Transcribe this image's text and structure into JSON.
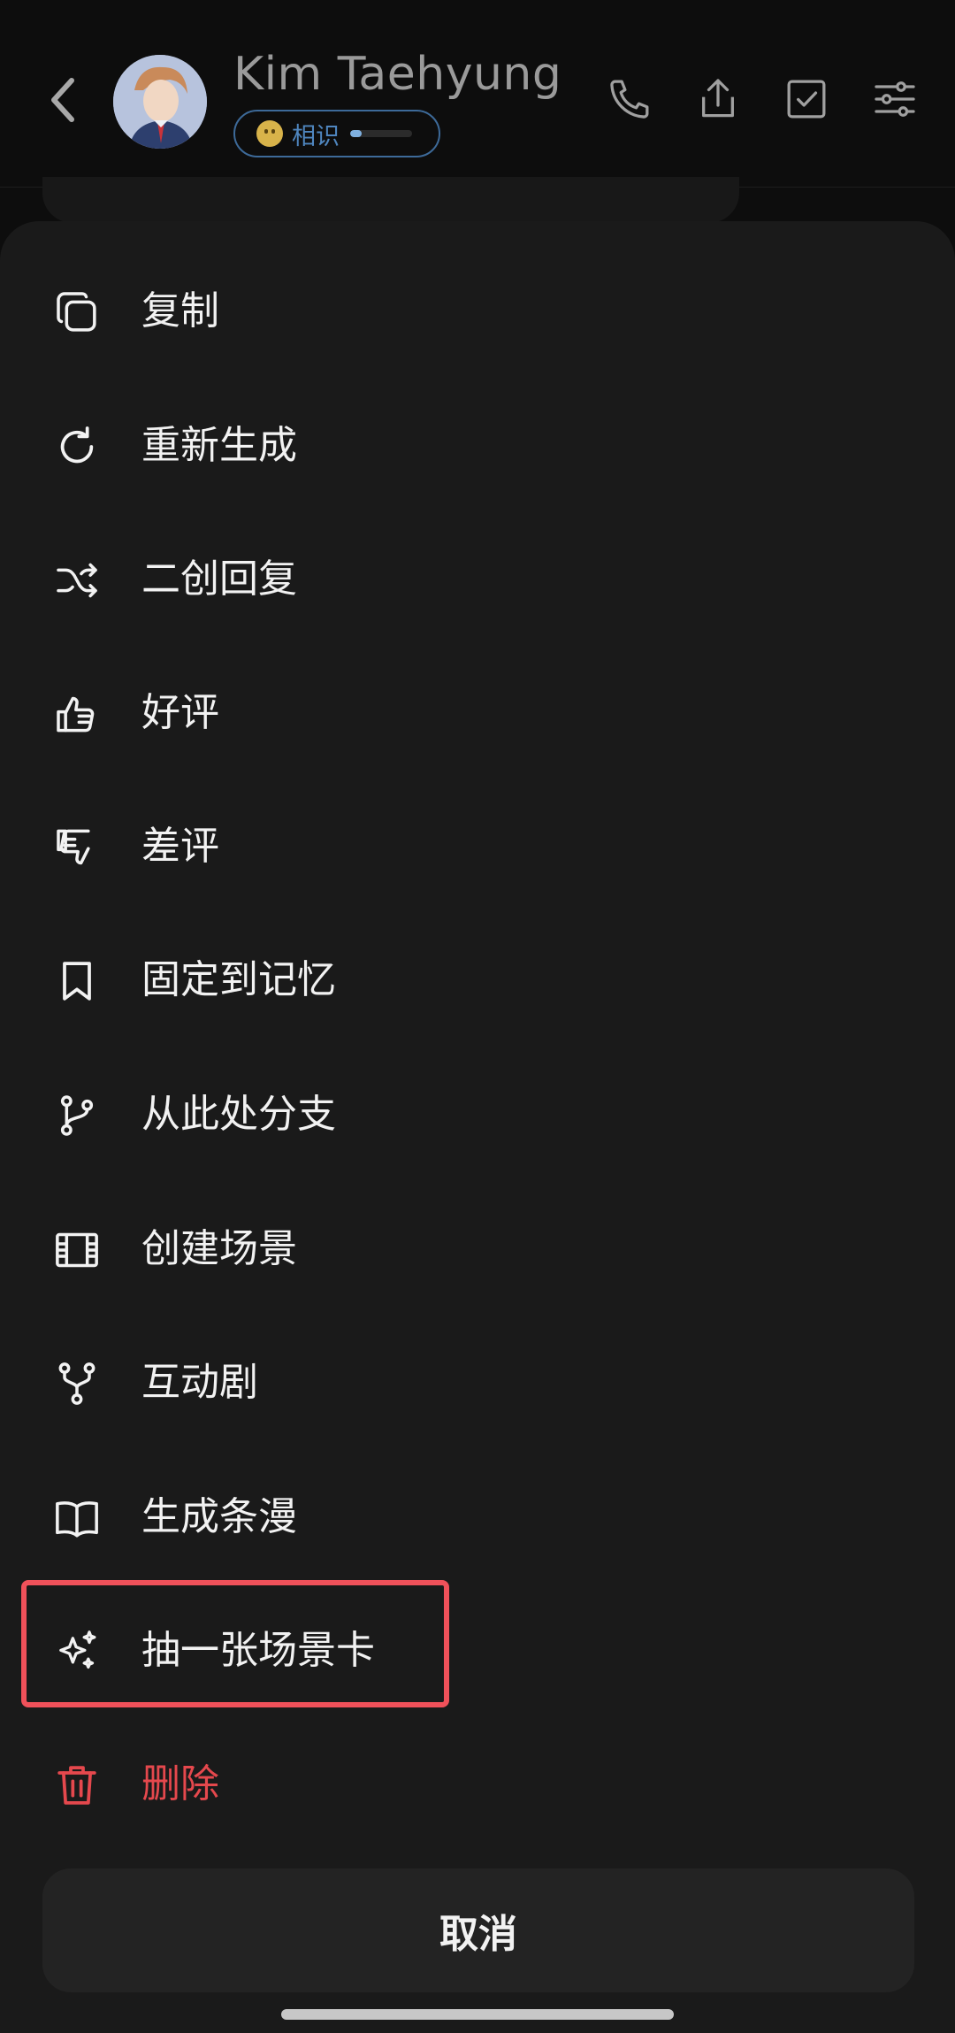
{
  "header": {
    "back_icon": "chevron-left-icon",
    "contact_name": "Kim Taehyung",
    "relation": {
      "emoji_icon": "smile-face-icon",
      "label": "相识",
      "progress": 0.18,
      "color": "#4f86bf"
    },
    "actions": [
      {
        "icon": "phone-icon"
      },
      {
        "icon": "share-icon"
      },
      {
        "icon": "checkbox-icon"
      },
      {
        "icon": "sliders-icon"
      }
    ]
  },
  "menu": {
    "items": [
      {
        "label": "复制",
        "icon": "copy-icon"
      },
      {
        "label": "重新生成",
        "icon": "regenerate-icon"
      },
      {
        "label": "二创回复",
        "icon": "shuffle-icon"
      },
      {
        "label": "好评",
        "icon": "thumbs-up-icon"
      },
      {
        "label": "差评",
        "icon": "thumbs-down-icon"
      },
      {
        "label": "固定到记忆",
        "icon": "bookmark-icon"
      },
      {
        "label": "从此处分支",
        "icon": "git-branch-icon"
      },
      {
        "label": "创建场景",
        "icon": "film-icon"
      },
      {
        "label": "互动剧",
        "icon": "fork-icon"
      },
      {
        "label": "生成条漫",
        "icon": "book-open-icon"
      },
      {
        "label": "抽一张场景卡",
        "icon": "sparkles-icon",
        "highlighted": true
      },
      {
        "label": "删除",
        "icon": "trash-icon",
        "danger": true
      }
    ],
    "cancel_label": "取消"
  },
  "colors": {
    "sheet_bg": "#1a1a1a",
    "danger": "#e5484d",
    "highlight_border": "#f0515a",
    "accent": "#4f86bf"
  }
}
